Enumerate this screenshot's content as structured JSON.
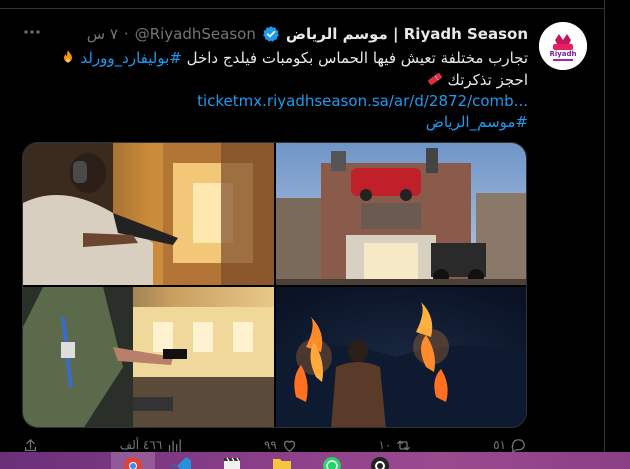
{
  "tweet": {
    "name": "موسم الرياض | Riyadh Season",
    "handle": "@RiyadhSeason",
    "time": "٧ س",
    "line1_text": "تجارب مختلفة تعيش فيها الحماس بكومبات فيلدج داخل",
    "line1_hashtag": "#بوليفارد_وورلد",
    "line2_text": "احجز تذكرتك",
    "link": "ticketmx.riyadhseason.sa/ar/d/2872/comb...",
    "hashtag2": "#موسم_الرياض"
  },
  "actions": {
    "reply_count": "٥١",
    "retweet_count": "١٠",
    "like_count": "٩٩",
    "views_count": "٤٦٦ ألف"
  },
  "icons": {
    "more": "more-icon",
    "verified": "verified-badge-icon",
    "fire": "fire-emoji-icon",
    "ticket": "ticket-emoji-icon",
    "reply": "reply-icon",
    "retweet": "retweet-icon",
    "like": "like-icon",
    "views": "views-icon",
    "share": "share-icon"
  },
  "colors": {
    "accent": "#1d9bf0",
    "muted": "#71767b",
    "text": "#e7e9ea",
    "verified": "#1d9bf0"
  }
}
